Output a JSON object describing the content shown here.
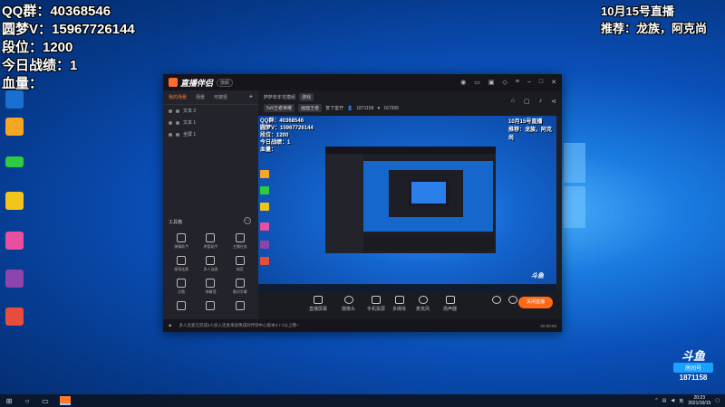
{
  "stream_overlay": {
    "left_lines": [
      "QQ群：40368546",
      "圆梦V：15967726144",
      "段位：1200",
      "今日战绩：1",
      "血量："
    ],
    "right_lines": [
      "10月15号直播",
      "推荐：龙族，阿克尚"
    ]
  },
  "desktop_icons": [
    {
      "name": "app-icon-1",
      "label": "",
      "color": "#1a6fd0"
    },
    {
      "name": "app-icon-2",
      "label": "",
      "color": "#f5a623"
    },
    {
      "name": "app-icon-3",
      "label": "",
      "color": "#2ecc40"
    },
    {
      "name": "app-icon-4",
      "label": "",
      "color": "#f0c419"
    },
    {
      "name": "app-icon-5",
      "label": "",
      "color": "#e94fa0"
    },
    {
      "name": "app-icon-6",
      "label": "",
      "color": "#8e44ad"
    },
    {
      "name": "app-icon-7",
      "label": "",
      "color": "#e74c3c"
    }
  ],
  "app": {
    "logo_text": "直播伴侣",
    "version_badge": "旗舰",
    "sidebar_tabs": [
      "我的场景",
      "场景",
      "可做竖"
    ],
    "scenes": [
      "文本 2",
      "文本 1",
      "全屏 1"
    ],
    "toolbox_title": "工具箱",
    "tools": [
      "弹幕助手",
      "房管助手",
      "主播任务",
      "视频连麦",
      "多人连麦",
      "抽奖",
      "点歌",
      "弹幕墙",
      "歌词字幕",
      "",
      "",
      ""
    ],
    "room_title": "萨萨年年花模组",
    "room_tag": "游戏",
    "category_chip": "5v5王者荣耀",
    "mode_chip": "画面王者",
    "share_label": "复下室开",
    "viewers": "1871158",
    "fans": "167905",
    "controls": [
      "直播屏幕",
      "摄像头",
      "手机投屏",
      "多媒体",
      "麦克风",
      "扬声器"
    ],
    "go_live_label": "关闭直播",
    "notice_text": "多人连麦已完成5人加入连麦来就像成同伴到中心版本3.7.2以上哦~",
    "status_items": [
      "00:00:00"
    ]
  },
  "preview": {
    "left_lines": [
      "QQ群：40368546",
      "圆梦V：15967726144",
      "段位：1200",
      "今日战绩：1",
      "血量："
    ],
    "right_lines": [
      "10月15号直播",
      "推荐：龙族，阿克尚"
    ],
    "douyu_text": "斗鱼"
  },
  "watermark": {
    "brand": "斗鱼",
    "badge": "房间号",
    "room_number": "1871158"
  },
  "taskbar": {
    "time": "20:23",
    "date": "2021/10/15",
    "lang": "英"
  }
}
